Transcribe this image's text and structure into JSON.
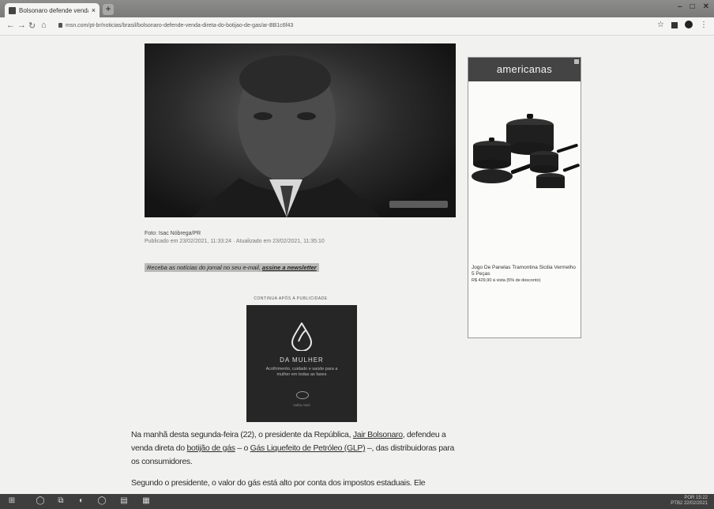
{
  "browser": {
    "tab_title": "Bolsonaro defende venda direta de...",
    "tab_close": "×",
    "new_tab": "+",
    "url": "msn.com/pt-br/noticias/brasil/bolsonaro-defende-venda-direta-do-botijao-de-gas/ar-BB1c6f43",
    "nav": {
      "back": "←",
      "forward": "→",
      "reload": "↻",
      "home": "⌂"
    },
    "window_controls": {
      "minimize": "–",
      "maximize": "□",
      "close": "✕"
    },
    "toolbar_icons": {
      "star": "☆",
      "menu": "⋮"
    }
  },
  "article": {
    "credit_line": "Foto: Isac Nóbrega/PR",
    "dates_line": "Publicado em 23/02/2021, 11:33:24 · Atualizado em 23/02/2021, 11:35:10",
    "promo_text": "Receba as notícias do jornal no seu e-mail, ",
    "promo_link": "assine a newsletter",
    "inline_ad_label": "CONTINUA APÓS A PUBLICIDADE",
    "inline_ad_brand": "DA MULHER",
    "inline_ad_tagline": "Acolhimento, cuidado e saúde para a mulher em todas as fases",
    "inline_ad_foot": "saiba mais",
    "paragraphs": [
      {
        "before": "Na manhã desta segunda-feira (22), o presidente da República, ",
        "link1": "Jair Bolsonaro",
        "mid": ", defendeu a venda direta do ",
        "link2": "botijão de gás",
        "mid2": " – o ",
        "link3": "Gás Liquefeito de Petróleo (GLP)",
        "after": " –, das distribuidoras para os consumidores."
      },
      {
        "before": "Segundo o presidente, o valor do gás está alto por conta dos impostos estaduais. Ele",
        "link1": "",
        "mid": "",
        "link2": "",
        "mid2": "",
        "link3": "",
        "after": ""
      }
    ]
  },
  "side_ad": {
    "brand": "americanas",
    "product_name": "Jogo De Panelas Tramontina Sicilia Vermelho 5 Peças",
    "product_price": "R$ 429,90 à vista (5% de desconto)"
  },
  "taskbar": {
    "start": "⊞",
    "apps": [
      "◯",
      "⧉",
      "◐",
      "◯",
      "▤",
      "▦"
    ],
    "tray_line1": "POR  15:22",
    "tray_line2": "PTB2  22/02/2021"
  },
  "colors": {
    "accent_tab": "#f4f4f2",
    "tabstrip": "#7e7e7c",
    "taskbar": "#3e3e3e",
    "ad_header": "#444444"
  }
}
